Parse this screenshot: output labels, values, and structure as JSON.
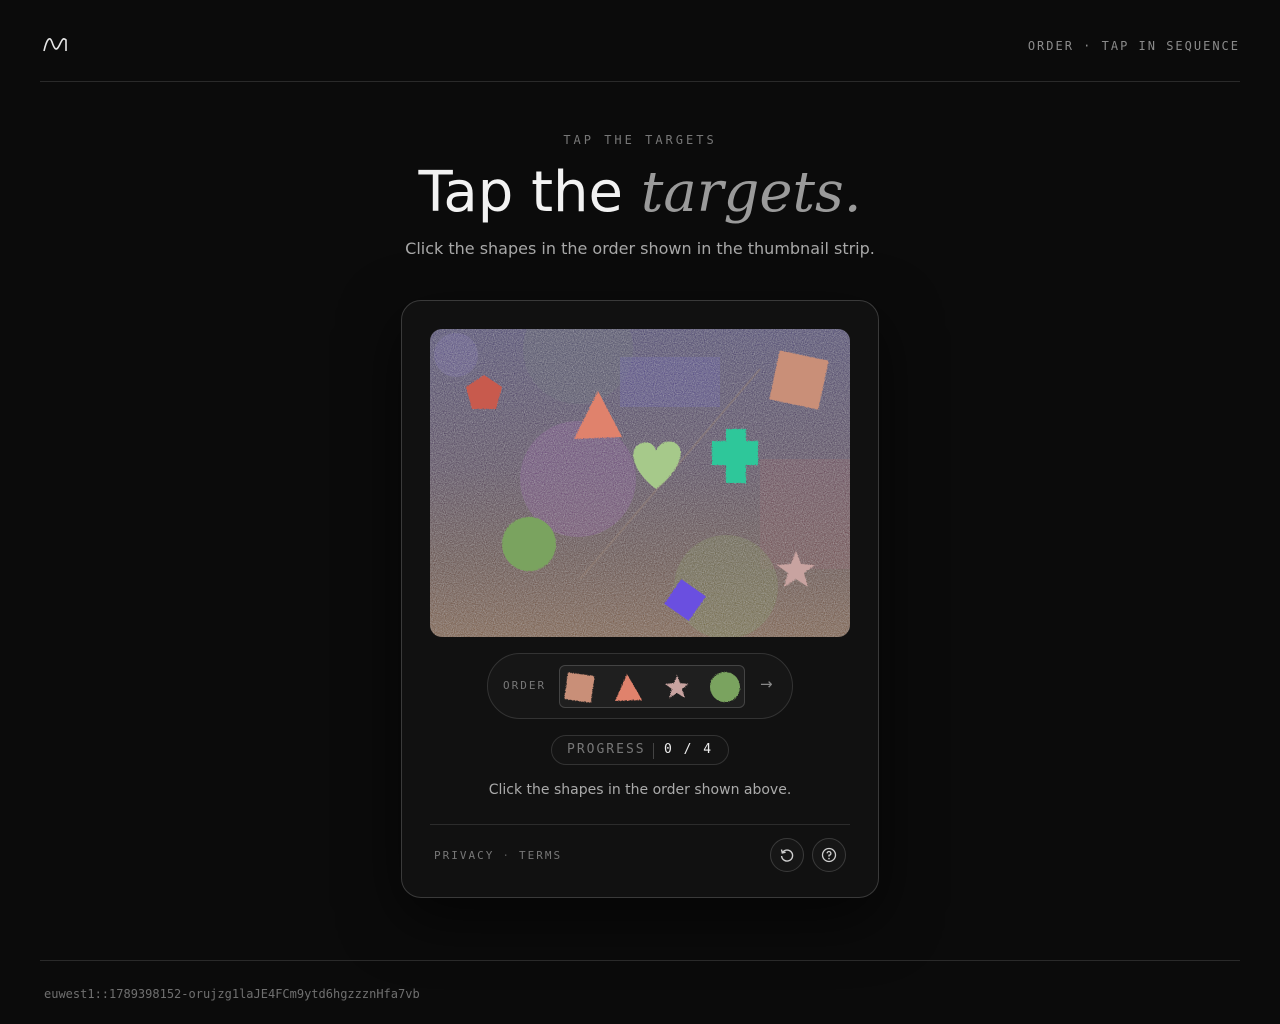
{
  "header": {
    "logo_icon": "wave-logo-icon",
    "mode_text": "ORDER · TAP IN SEQUENCE"
  },
  "hero": {
    "eyebrow": "TAP THE TARGETS",
    "title_plain": "Tap the",
    "title_emphasis": "targets.",
    "subtitle": "Click the shapes in the order shown in the thumbnail strip."
  },
  "challenge": {
    "canvas_shapes": [
      {
        "shape": "pentagon",
        "color": "#c85a4e"
      },
      {
        "shape": "triangle",
        "color": "#e0826c"
      },
      {
        "shape": "heart",
        "color": "#a6c98a"
      },
      {
        "shape": "cross",
        "color": "#2fc79a"
      },
      {
        "shape": "square",
        "color": "#c98f78"
      },
      {
        "shape": "circle",
        "color": "#7aa35e"
      },
      {
        "shape": "diamond",
        "color": "#6a4fe0"
      },
      {
        "shape": "star",
        "color": "#c8a3a0"
      }
    ],
    "order_label": "ORDER",
    "order_sequence": [
      {
        "shape": "square",
        "color": "#c98f78"
      },
      {
        "shape": "triangle",
        "color": "#e0826c"
      },
      {
        "shape": "star",
        "color": "#c8a3a0"
      },
      {
        "shape": "circle",
        "color": "#7aa35e"
      }
    ],
    "next_icon": "arrow-right-icon",
    "progress_label": "PROGRESS",
    "progress_value": "0 / 4",
    "instruction": "Click the shapes in the order shown above.",
    "links": {
      "privacy": "PRIVACY",
      "separator": "·",
      "terms": "TERMS"
    },
    "reload_icon": "reload-icon",
    "help_icon": "help-icon"
  },
  "footer": {
    "session_id": "euwest1::1789398152-orujzg1laJE4FCm9ytd6hgzzznHfa7vb"
  }
}
